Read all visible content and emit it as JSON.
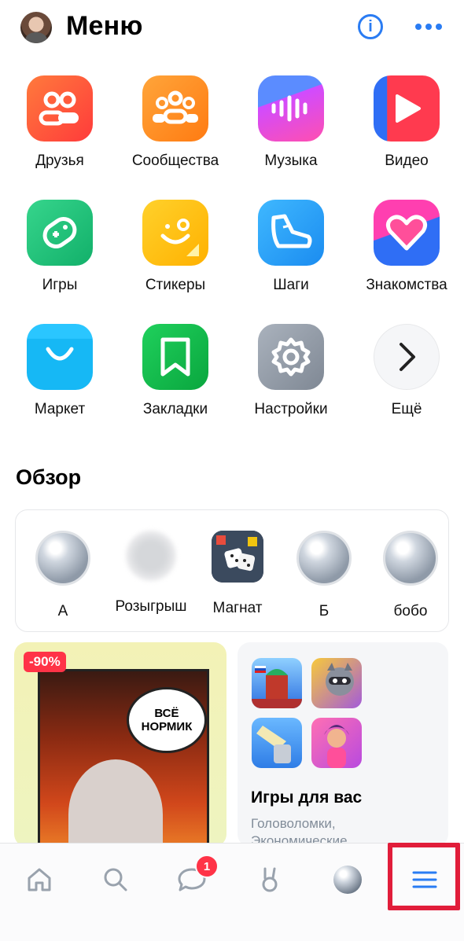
{
  "header": {
    "title": "Меню"
  },
  "apps": [
    {
      "label": "Друзья",
      "icon": "friends-icon"
    },
    {
      "label": "Сообщества",
      "icon": "communities-icon"
    },
    {
      "label": "Музыка",
      "icon": "music-icon"
    },
    {
      "label": "Видео",
      "icon": "video-icon"
    },
    {
      "label": "Игры",
      "icon": "gamepad-icon"
    },
    {
      "label": "Стикеры",
      "icon": "sticker-icon"
    },
    {
      "label": "Шаги",
      "icon": "sneaker-icon"
    },
    {
      "label": "Знакомства",
      "icon": "heart-icon"
    },
    {
      "label": "Маркет",
      "icon": "bag-icon"
    },
    {
      "label": "Закладки",
      "icon": "bookmark-icon"
    },
    {
      "label": "Настройки",
      "icon": "gear-icon"
    },
    {
      "label": "Ещё",
      "icon": "chevron-right-icon"
    }
  ],
  "overview": {
    "title": "Обзор",
    "items": [
      {
        "label": "А"
      },
      {
        "label": "Розыгрыш"
      },
      {
        "label": "Магнат"
      },
      {
        "label": "Б"
      },
      {
        "label": "бобо"
      }
    ]
  },
  "promo": {
    "badge": "-90%",
    "bubble_line1": "ВСЁ",
    "bubble_line2": "НОРМИК"
  },
  "games": {
    "title": "Игры для вас",
    "subtitle_line1": "Головоломки,",
    "subtitle_line2": "Экономические"
  },
  "tabbar": {
    "messages_badge": "1"
  },
  "colors": {
    "accent": "#2a7cf3",
    "badge_red": "#ff3347",
    "highlight": "#e11d3a"
  }
}
